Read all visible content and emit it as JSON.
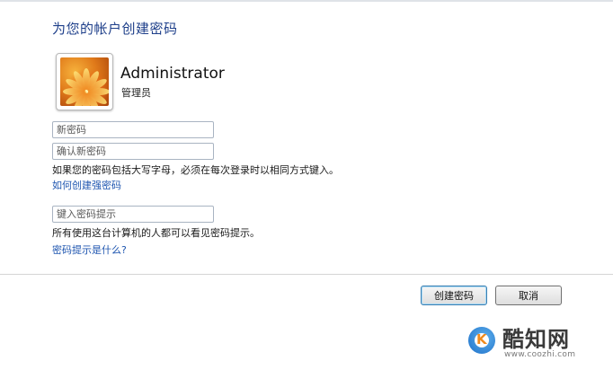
{
  "page": {
    "title": "为您的帐户创建密码"
  },
  "user": {
    "name": "Administrator",
    "role": "管理员",
    "avatar_icon": "flower-avatar-icon"
  },
  "form": {
    "new_password_placeholder": "新密码",
    "confirm_password_placeholder": "确认新密码",
    "caps_note": "如果您的密码包括大写字母，必须在每次登录时以相同方式键入。",
    "strong_password_link": "如何创建强密码",
    "hint_placeholder": "键入密码提示",
    "hint_note": "所有使用这台计算机的人都可以看见密码提示。",
    "hint_link": "密码提示是什么?"
  },
  "buttons": {
    "create": "创建密码",
    "cancel": "取消"
  },
  "watermark": {
    "logo_letter": "K",
    "brand": "酷知网",
    "url": "www.coozhi.com"
  },
  "colors": {
    "title": "#1e3f8a",
    "link": "#1f56b0",
    "watermark_blue": "#1c6fc9",
    "watermark_orange": "#f08a1c"
  }
}
